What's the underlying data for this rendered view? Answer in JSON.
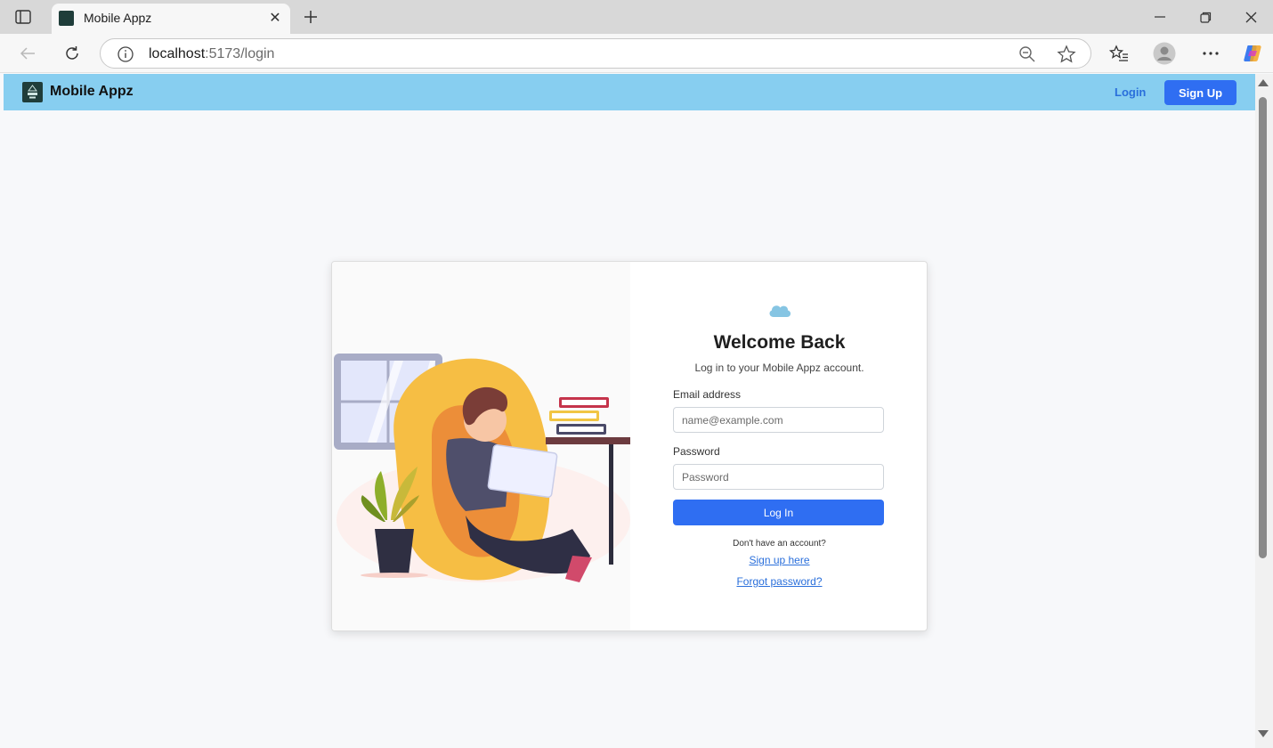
{
  "browser": {
    "tab_title": "Mobile Appz",
    "url_host": "localhost",
    "url_path": ":5173/login"
  },
  "navbar": {
    "brand": "Mobile Appz",
    "login_label": "Login",
    "signup_label": "Sign Up",
    "background_color": "#87cef0",
    "accent_color": "#2f6ef2"
  },
  "login": {
    "title": "Welcome Back",
    "subtitle": "Log in to your Mobile Appz account.",
    "email_label": "Email address",
    "email_placeholder": "name@example.com",
    "password_label": "Password",
    "password_placeholder": "Password",
    "submit_label": "Log In",
    "no_account_text": "Don't have an account?",
    "signup_link": "Sign up here",
    "forgot_link": "Forgot password?"
  }
}
